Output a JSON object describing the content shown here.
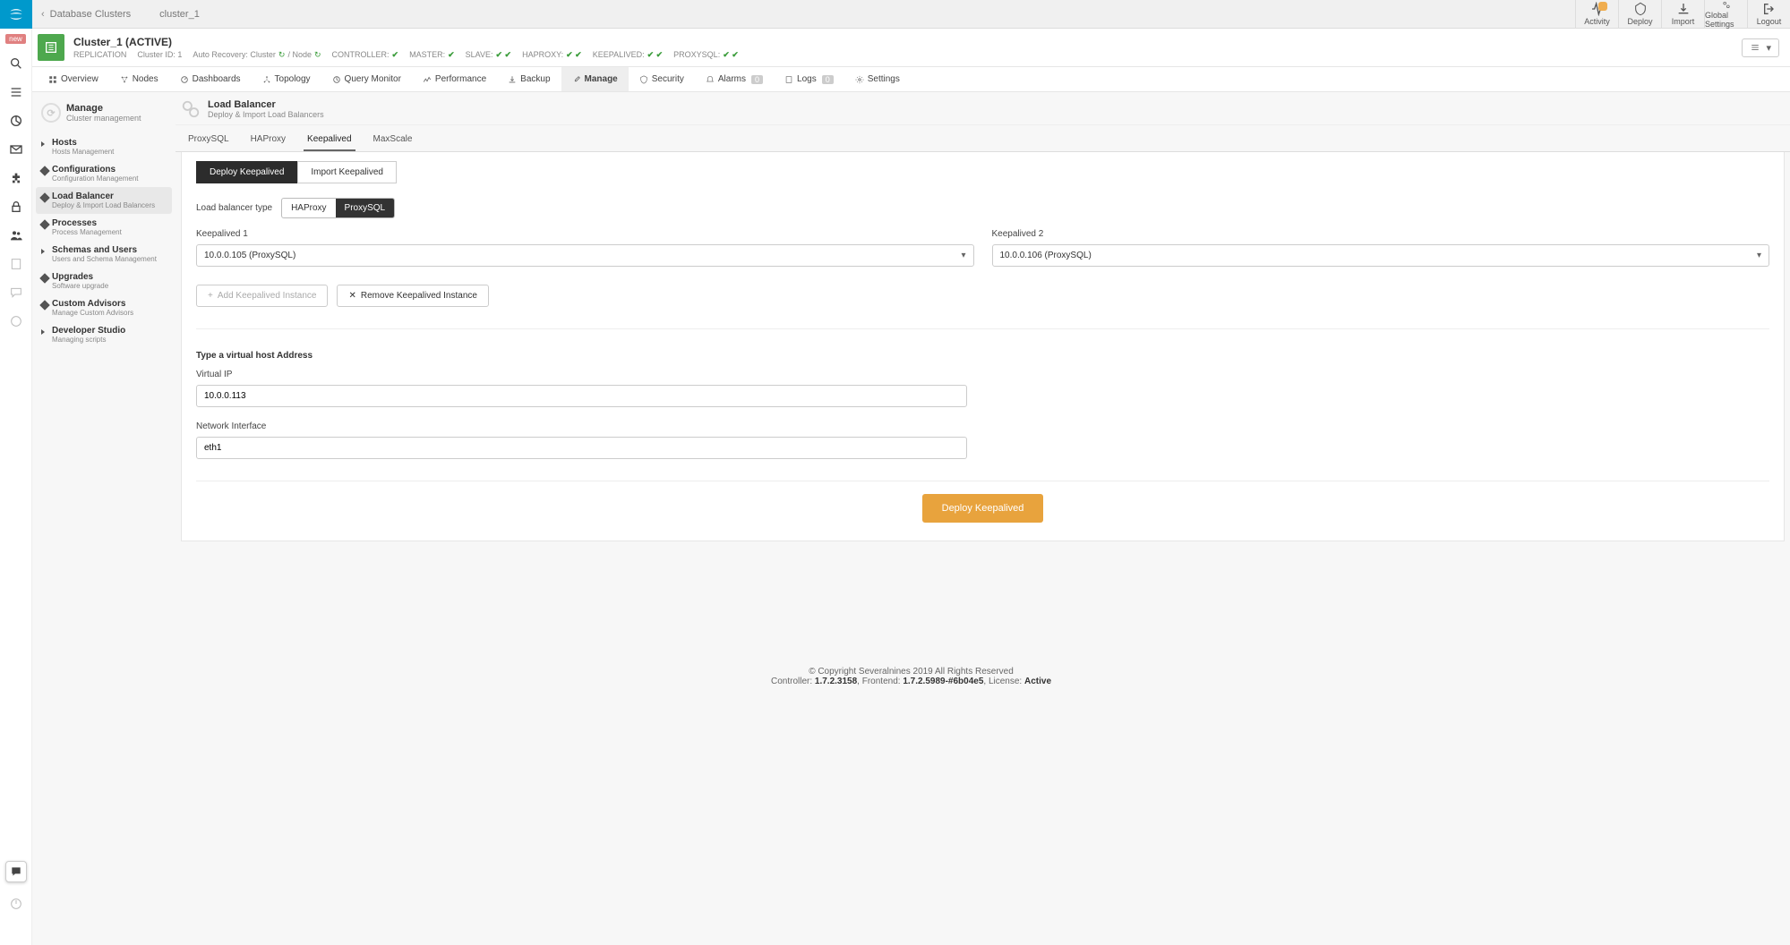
{
  "header": {
    "breadcrumb_parent": "Database Clusters",
    "breadcrumb_current": "cluster_1",
    "actions": {
      "activity": "Activity",
      "deploy": "Deploy",
      "import": "Import",
      "global": "Global Settings",
      "logout": "Logout"
    }
  },
  "sidebar": {
    "new": "new"
  },
  "cluster": {
    "name": "Cluster_1 (ACTIVE)",
    "type": "REPLICATION",
    "id_label": "Cluster ID: 1",
    "auto_recovery": "Auto Recovery: Cluster",
    "auto_recovery_node": "/ Node",
    "statuses": [
      {
        "k": "CONTROLLER:",
        "v": "✔"
      },
      {
        "k": "MASTER:",
        "v": "✔"
      },
      {
        "k": "SLAVE:",
        "v": "✔ ✔"
      },
      {
        "k": "HAPROXY:",
        "v": "✔ ✔"
      },
      {
        "k": "KEEPALIVED:",
        "v": "✔ ✔"
      },
      {
        "k": "PROXYSQL:",
        "v": "✔ ✔"
      }
    ]
  },
  "tabs": [
    {
      "label": "Overview"
    },
    {
      "label": "Nodes"
    },
    {
      "label": "Dashboards"
    },
    {
      "label": "Topology"
    },
    {
      "label": "Query Monitor"
    },
    {
      "label": "Performance"
    },
    {
      "label": "Backup"
    },
    {
      "label": "Manage",
      "active": true
    },
    {
      "label": "Security"
    },
    {
      "label": "Alarms",
      "badge": "0"
    },
    {
      "label": "Logs",
      "badge": "0"
    },
    {
      "label": "Settings"
    }
  ],
  "side_menu": {
    "title": "Manage",
    "subtitle": "Cluster management",
    "items": [
      {
        "t": "Hosts",
        "s": "Hosts Management"
      },
      {
        "t": "Configurations",
        "s": "Configuration Management"
      },
      {
        "t": "Load Balancer",
        "s": "Deploy & Import Load Balancers",
        "active": true
      },
      {
        "t": "Processes",
        "s": "Process Management"
      },
      {
        "t": "Schemas and Users",
        "s": "Users and Schema Management"
      },
      {
        "t": "Upgrades",
        "s": "Software upgrade"
      },
      {
        "t": "Custom Advisors",
        "s": "Manage Custom Advisors"
      },
      {
        "t": "Developer Studio",
        "s": "Managing scripts"
      }
    ]
  },
  "form": {
    "title": "Load Balancer",
    "subtitle": "Deploy & Import Load Balancers",
    "tabs": [
      "ProxySQL",
      "HAProxy",
      "Keepalived",
      "MaxScale"
    ],
    "tabs_active": "Keepalived",
    "deploy_tabs": {
      "deploy": "Deploy Keepalived",
      "import": "Import Keepalived"
    },
    "lb_type_label": "Load balancer type",
    "lb_type_options": {
      "haproxy": "HAProxy",
      "proxysql": "ProxySQL"
    },
    "keepalived1_label": "Keepalived 1",
    "keepalived1_value": "10.0.0.105 (ProxySQL)",
    "keepalived2_label": "Keepalived 2",
    "keepalived2_value": "10.0.0.106 (ProxySQL)",
    "add_instance": "Add Keepalived Instance",
    "remove_instance": "Remove Keepalived Instance",
    "vhost_title": "Type a virtual host Address",
    "vip_label": "Virtual IP",
    "vip_value": "10.0.0.113",
    "iface_label": "Network Interface",
    "iface_value": "eth1",
    "deploy_btn": "Deploy Keepalived"
  },
  "footer": {
    "copy": "© Copyright Severalnines 2019 All Rights Reserved",
    "ctrl_label": "Controller:",
    "ctrl": "1.7.2.3158",
    "fe_label": ", Frontend:",
    "fe": "1.7.2.5989-#6b04e5",
    "lic_label": ", License:",
    "lic": "Active"
  }
}
